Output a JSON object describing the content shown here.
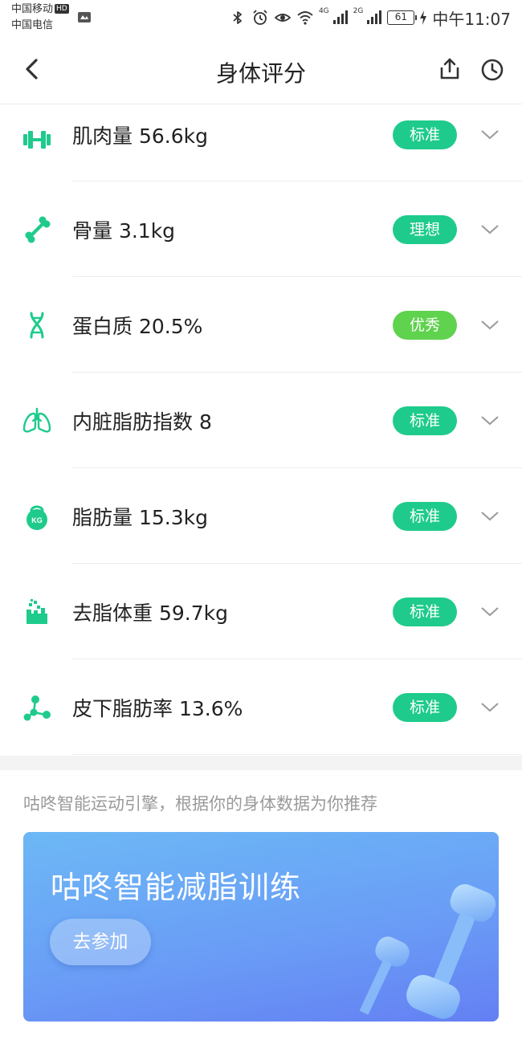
{
  "status_bar": {
    "carrier_1": "中国移动",
    "carrier_1_badge": "HD",
    "carrier_2": "中国电信",
    "net_1": "4G",
    "net_2": "2G",
    "battery": "61",
    "time": "中午11:07"
  },
  "nav": {
    "title": "身体评分",
    "icons": [
      "back-arrow-icon",
      "share-icon",
      "history-clock-icon"
    ]
  },
  "metrics": [
    {
      "label": "肌肉量 56.6kg",
      "badge": "标准",
      "badge_color": "#1ecb8c",
      "icon": "dumbbell-icon"
    },
    {
      "label": "骨量 3.1kg",
      "badge": "理想",
      "badge_color": "#1ecb8c",
      "icon": "bone-icon"
    },
    {
      "label": "蛋白质 20.5%",
      "badge": "优秀",
      "badge_color": "#5fd24e",
      "icon": "dna-icon"
    },
    {
      "label": "内脏脂肪指数 8",
      "badge": "标准",
      "badge_color": "#1ecb8c",
      "icon": "lungs-icon"
    },
    {
      "label": "脂肪量 15.3kg",
      "badge": "标准",
      "badge_color": "#1ecb8c",
      "icon": "kettlebell-kg-icon"
    },
    {
      "label": "去脂体重 59.7kg",
      "badge": "标准",
      "badge_color": "#1ecb8c",
      "icon": "lean-mass-icon"
    },
    {
      "label": "皮下脂肪率 13.6%",
      "badge": "标准",
      "badge_color": "#1ecb8c",
      "icon": "molecule-icon"
    }
  ],
  "recommendation": {
    "text": "咕咚智能运动引擎，根据你的身体数据为你推荐",
    "banner_title": "咕咚智能减脂训练",
    "banner_button": "去参加"
  },
  "colors": {
    "accent_green": "#1ecb8c",
    "excellent_green": "#5fd24e",
    "banner_blue": "#6a9ef6"
  }
}
